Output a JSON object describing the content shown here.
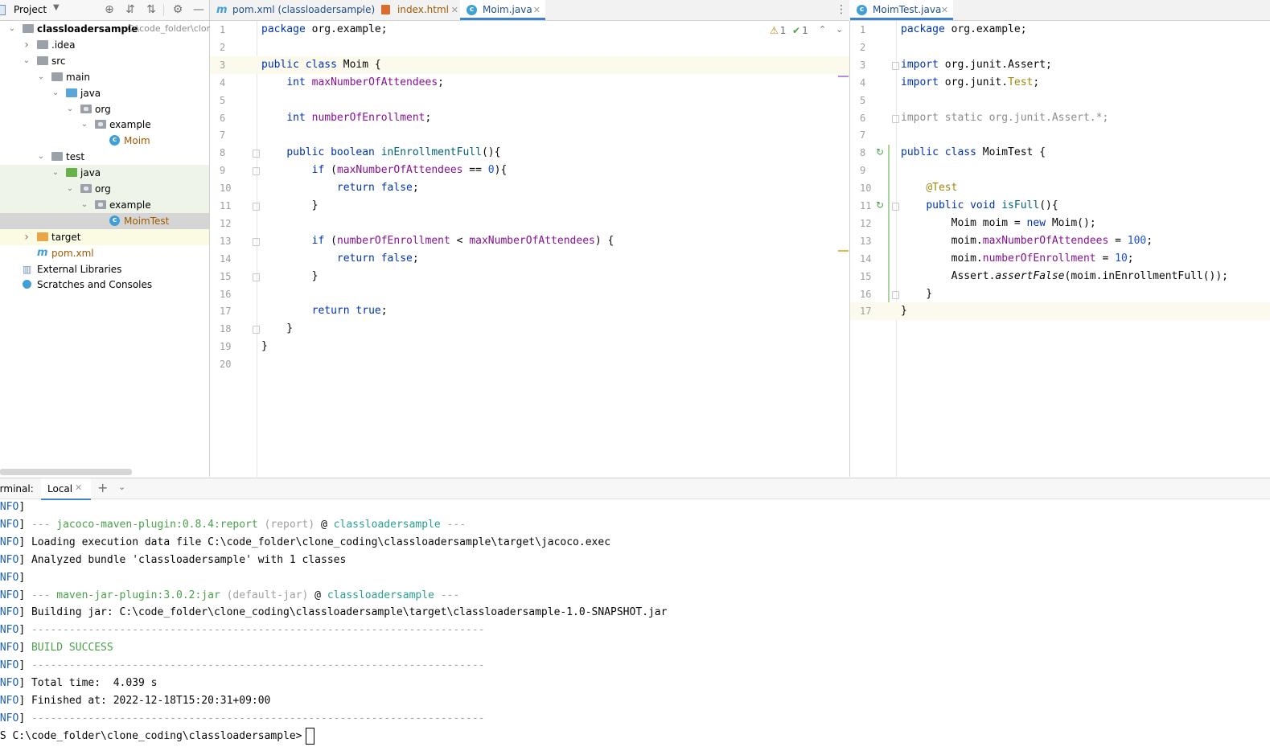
{
  "project_panel": {
    "title": "Project",
    "tree": [
      {
        "label": "classloadersample",
        "path": "C:\\code_folder\\clone",
        "depth": 0,
        "icon": "module-folder-icon",
        "expanded": true,
        "bold": true
      },
      {
        "label": ".idea",
        "depth": 1,
        "icon": "folder-icon",
        "expanded": false
      },
      {
        "label": "src",
        "depth": 1,
        "icon": "folder-icon",
        "expanded": true
      },
      {
        "label": "main",
        "depth": 2,
        "icon": "folder-icon",
        "expanded": true
      },
      {
        "label": "java",
        "depth": 3,
        "icon": "source-folder-icon",
        "expanded": true
      },
      {
        "label": "org",
        "depth": 4,
        "icon": "package-icon",
        "expanded": true
      },
      {
        "label": "example",
        "depth": 5,
        "icon": "package-icon",
        "expanded": true
      },
      {
        "label": "Moim",
        "depth": 6,
        "icon": "java-class-icon"
      },
      {
        "label": "test",
        "depth": 2,
        "icon": "folder-icon",
        "expanded": true
      },
      {
        "label": "java",
        "depth": 3,
        "icon": "test-folder-icon",
        "expanded": true
      },
      {
        "label": "org",
        "depth": 4,
        "icon": "package-icon",
        "expanded": true
      },
      {
        "label": "example",
        "depth": 5,
        "icon": "package-icon",
        "expanded": true
      },
      {
        "label": "MoimTest",
        "depth": 6,
        "icon": "java-class-icon",
        "selected": true
      },
      {
        "label": "target",
        "depth": 1,
        "icon": "excluded-folder-icon",
        "expanded": false
      },
      {
        "label": "pom.xml",
        "depth": 1,
        "icon": "maven-icon"
      },
      {
        "label": "External Libraries",
        "depth": 0,
        "icon": "libraries-icon"
      },
      {
        "label": "Scratches and Consoles",
        "depth": 0,
        "icon": "scratches-icon"
      }
    ]
  },
  "left_tabs": [
    {
      "label": "pom.xml (classloadersample)",
      "icon": "maven-icon",
      "active": false
    },
    {
      "label": "index.html",
      "icon": "html-icon",
      "active": false
    },
    {
      "label": "Moim.java",
      "icon": "java-class-icon",
      "active": true
    }
  ],
  "right_tabs": [
    {
      "label": "MoimTest.java",
      "icon": "java-test-class-icon",
      "active": true
    }
  ],
  "inspection": {
    "warnings": "1",
    "ok": "1"
  },
  "left_editor": {
    "current_line": 3,
    "lines": [
      [
        {
          "t": "package ",
          "c": "kw"
        },
        {
          "t": "org.example;"
        }
      ],
      [],
      [
        {
          "t": "public class ",
          "c": "kw"
        },
        {
          "t": "Moim {"
        }
      ],
      [
        {
          "t": "    "
        },
        {
          "t": "int ",
          "c": "kw"
        },
        {
          "t": "maxNumberOfAttendees",
          "c": "fld"
        },
        {
          "t": ";"
        }
      ],
      [],
      [
        {
          "t": "    "
        },
        {
          "t": "int ",
          "c": "kw"
        },
        {
          "t": "numberOfEnrollment",
          "c": "fld"
        },
        {
          "t": ";"
        }
      ],
      [],
      [
        {
          "t": "    "
        },
        {
          "t": "public boolean ",
          "c": "kw"
        },
        {
          "t": "inEnrollmentFull",
          "c": "fn"
        },
        {
          "t": "(){"
        }
      ],
      [
        {
          "t": "        "
        },
        {
          "t": "if ",
          "c": "kw"
        },
        {
          "t": "("
        },
        {
          "t": "maxNumberOfAttendees",
          "c": "fld"
        },
        {
          "t": " == "
        },
        {
          "t": "0",
          "c": "num"
        },
        {
          "t": "){"
        }
      ],
      [
        {
          "t": "            "
        },
        {
          "t": "return false",
          "c": "kw"
        },
        {
          "t": ";"
        }
      ],
      [
        {
          "t": "        }"
        }
      ],
      [],
      [
        {
          "t": "        "
        },
        {
          "t": "if ",
          "c": "kw"
        },
        {
          "t": "("
        },
        {
          "t": "numberOfEnrollment",
          "c": "fld"
        },
        {
          "t": " < "
        },
        {
          "t": "maxNumberOfAttendees",
          "c": "fld"
        },
        {
          "t": ") {"
        }
      ],
      [
        {
          "t": "            "
        },
        {
          "t": "return false",
          "c": "kw"
        },
        {
          "t": ";"
        }
      ],
      [
        {
          "t": "        }"
        }
      ],
      [],
      [
        {
          "t": "        "
        },
        {
          "t": "return true",
          "c": "kw"
        },
        {
          "t": ";"
        }
      ],
      [
        {
          "t": "    }"
        }
      ],
      [
        {
          "t": "}"
        }
      ],
      []
    ]
  },
  "right_editor": {
    "current_line": 17,
    "lines": [
      [
        {
          "t": "package ",
          "c": "kw"
        },
        {
          "t": "org.example;"
        }
      ],
      [],
      [
        {
          "t": "import ",
          "c": "kw"
        },
        {
          "t": "org.junit.Assert;"
        }
      ],
      [
        {
          "t": "import ",
          "c": "kw"
        },
        {
          "t": "org.junit."
        },
        {
          "t": "Test",
          "c": "ann"
        },
        {
          "t": ";"
        }
      ],
      [],
      [
        {
          "t": "import static org.junit.Assert.*;",
          "c": "cm"
        }
      ],
      [],
      [
        {
          "t": "public class ",
          "c": "kw"
        },
        {
          "t": "MoimTest {"
        }
      ],
      [],
      [
        {
          "t": "    "
        },
        {
          "t": "@Test",
          "c": "ann"
        }
      ],
      [
        {
          "t": "    "
        },
        {
          "t": "public void ",
          "c": "kw"
        },
        {
          "t": "isFull",
          "c": "fn"
        },
        {
          "t": "(){"
        }
      ],
      [
        {
          "t": "        Moim moim = "
        },
        {
          "t": "new ",
          "c": "kw"
        },
        {
          "t": "Moim();"
        }
      ],
      [
        {
          "t": "        moim."
        },
        {
          "t": "maxNumberOfAttendees",
          "c": "fld"
        },
        {
          "t": " = "
        },
        {
          "t": "100",
          "c": "num"
        },
        {
          "t": ";"
        }
      ],
      [
        {
          "t": "        moim."
        },
        {
          "t": "numberOfEnrollment",
          "c": "fld"
        },
        {
          "t": " = "
        },
        {
          "t": "10",
          "c": "num"
        },
        {
          "t": ";"
        }
      ],
      [
        {
          "t": "        Assert."
        },
        {
          "t": "assertFalse",
          "c": "it"
        },
        {
          "t": "(moim.inEnrollmentFull());"
        }
      ],
      [
        {
          "t": "    }"
        }
      ],
      [
        {
          "t": "}"
        }
      ]
    ]
  },
  "terminal": {
    "label": "Terminal:",
    "tab": "Local",
    "lines": [
      [
        {
          "t": "INFO",
          "c": "tinfo"
        },
        {
          "t": "]"
        }
      ],
      [
        {
          "t": "INFO",
          "c": "tinfo"
        },
        {
          "t": "] "
        },
        {
          "t": "--- ",
          "c": "tdim"
        },
        {
          "t": "jacoco-maven-plugin:0.8.4:report",
          "c": "tgreen"
        },
        {
          "t": " (report)",
          "c": "tdim"
        },
        {
          "t": " @ "
        },
        {
          "t": "classloadersample",
          "c": "tteal"
        },
        {
          "t": " ---",
          "c": "tdim"
        }
      ],
      [
        {
          "t": "INFO",
          "c": "tinfo"
        },
        {
          "t": "] Loading execution data file C:\\code_folder\\clone_coding\\classloadersample\\target\\jacoco.exec"
        }
      ],
      [
        {
          "t": "INFO",
          "c": "tinfo"
        },
        {
          "t": "] Analyzed bundle 'classloadersample' with 1 classes"
        }
      ],
      [
        {
          "t": "INFO",
          "c": "tinfo"
        },
        {
          "t": "]"
        }
      ],
      [
        {
          "t": "INFO",
          "c": "tinfo"
        },
        {
          "t": "] "
        },
        {
          "t": "--- ",
          "c": "tdim"
        },
        {
          "t": "maven-jar-plugin:3.0.2:jar",
          "c": "tgreen"
        },
        {
          "t": " (default-jar)",
          "c": "tdim"
        },
        {
          "t": " @ "
        },
        {
          "t": "classloadersample",
          "c": "tteal"
        },
        {
          "t": " ---",
          "c": "tdim"
        }
      ],
      [
        {
          "t": "INFO",
          "c": "tinfo"
        },
        {
          "t": "] Building jar: C:\\code_folder\\clone_coding\\classloadersample\\target\\classloadersample-1.0-SNAPSHOT.jar"
        }
      ],
      [
        {
          "t": "INFO",
          "c": "tinfo"
        },
        {
          "t": "] "
        },
        {
          "t": "------------------------------------------------------------------------",
          "c": "tdim"
        }
      ],
      [
        {
          "t": "INFO",
          "c": "tinfo"
        },
        {
          "t": "] "
        },
        {
          "t": "BUILD SUCCESS",
          "c": "tgreen"
        }
      ],
      [
        {
          "t": "INFO",
          "c": "tinfo"
        },
        {
          "t": "] "
        },
        {
          "t": "------------------------------------------------------------------------",
          "c": "tdim"
        }
      ],
      [
        {
          "t": "INFO",
          "c": "tinfo"
        },
        {
          "t": "] Total time:  4.039 s"
        }
      ],
      [
        {
          "t": "INFO",
          "c": "tinfo"
        },
        {
          "t": "] Finished at: 2022-12-18T15:20:31+09:00"
        }
      ],
      [
        {
          "t": "INFO",
          "c": "tinfo"
        },
        {
          "t": "] "
        },
        {
          "t": "------------------------------------------------------------------------",
          "c": "tdim"
        }
      ]
    ],
    "prompt": "PS C:\\code_folder\\clone_coding\\classloadersample>"
  }
}
